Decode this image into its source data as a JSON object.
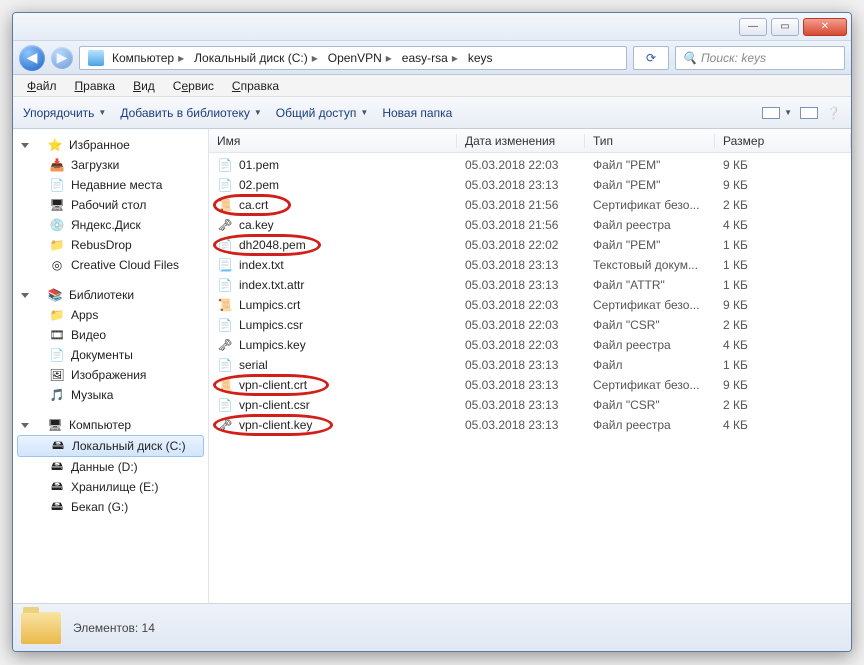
{
  "window": {
    "title": "keys"
  },
  "breadcrumb": [
    "Компьютер",
    "Локальный диск (C:)",
    "OpenVPN",
    "easy-rsa",
    "keys"
  ],
  "search": {
    "placeholder": "Поиск: keys"
  },
  "menubar": [
    "Файл",
    "Правка",
    "Вид",
    "Сервис",
    "Справка"
  ],
  "menubar_underline_index": [
    0,
    0,
    0,
    0,
    0
  ],
  "toolbar": {
    "organize": "Упорядочить",
    "addlib": "Добавить в библиотеку",
    "share": "Общий доступ",
    "newfolder": "Новая папка"
  },
  "columns": {
    "name": "Имя",
    "date": "Дата изменения",
    "type": "Тип",
    "size": "Размер"
  },
  "files": [
    {
      "name": "01.pem",
      "date": "05.03.2018 22:03",
      "type": "Файл \"PEM\"",
      "size": "9 КБ",
      "icon": "page",
      "highlight": false
    },
    {
      "name": "02.pem",
      "date": "05.03.2018 23:13",
      "type": "Файл \"PEM\"",
      "size": "9 КБ",
      "icon": "page",
      "highlight": false
    },
    {
      "name": "ca.crt",
      "date": "05.03.2018 21:56",
      "type": "Сертификат безо...",
      "size": "2 КБ",
      "icon": "cert",
      "highlight": true,
      "ringw": 78
    },
    {
      "name": "ca.key",
      "date": "05.03.2018 21:56",
      "type": "Файл реестра",
      "size": "4 КБ",
      "icon": "reg",
      "highlight": false
    },
    {
      "name": "dh2048.pem",
      "date": "05.03.2018 22:02",
      "type": "Файл \"PEM\"",
      "size": "1 КБ",
      "icon": "page",
      "highlight": true,
      "ringw": 108
    },
    {
      "name": "index.txt",
      "date": "05.03.2018 23:13",
      "type": "Текстовый докум...",
      "size": "1 КБ",
      "icon": "txt",
      "highlight": false
    },
    {
      "name": "index.txt.attr",
      "date": "05.03.2018 23:13",
      "type": "Файл \"ATTR\"",
      "size": "1 КБ",
      "icon": "page",
      "highlight": false
    },
    {
      "name": "Lumpics.crt",
      "date": "05.03.2018 22:03",
      "type": "Сертификат безо...",
      "size": "9 КБ",
      "icon": "cert",
      "highlight": false
    },
    {
      "name": "Lumpics.csr",
      "date": "05.03.2018 22:03",
      "type": "Файл \"CSR\"",
      "size": "2 КБ",
      "icon": "page",
      "highlight": false
    },
    {
      "name": "Lumpics.key",
      "date": "05.03.2018 22:03",
      "type": "Файл реестра",
      "size": "4 КБ",
      "icon": "reg",
      "highlight": false
    },
    {
      "name": "serial",
      "date": "05.03.2018 23:13",
      "type": "Файл",
      "size": "1 КБ",
      "icon": "page",
      "highlight": false
    },
    {
      "name": "vpn-client.crt",
      "date": "05.03.2018 23:13",
      "type": "Сертификат безо...",
      "size": "9 КБ",
      "icon": "cert",
      "highlight": true,
      "ringw": 116
    },
    {
      "name": "vpn-client.csr",
      "date": "05.03.2018 23:13",
      "type": "Файл \"CSR\"",
      "size": "2 КБ",
      "icon": "page",
      "highlight": false
    },
    {
      "name": "vpn-client.key",
      "date": "05.03.2018 23:13",
      "type": "Файл реестра",
      "size": "4 КБ",
      "icon": "reg",
      "highlight": true,
      "ringw": 120
    }
  ],
  "nav": {
    "favorites": {
      "header": "Избранное",
      "items": [
        {
          "label": "Загрузки",
          "icon": "📥"
        },
        {
          "label": "Недавние места",
          "icon": "📄"
        },
        {
          "label": "Рабочий стол",
          "icon": "🖥"
        },
        {
          "label": "Яндекс.Диск",
          "icon": "💿"
        },
        {
          "label": "RebusDrop",
          "icon": "📁"
        },
        {
          "label": "Creative Cloud Files",
          "icon": "◎"
        }
      ]
    },
    "libraries": {
      "header": "Библиотеки",
      "items": [
        {
          "label": "Apps",
          "icon": "📁"
        },
        {
          "label": "Видео",
          "icon": "🎞"
        },
        {
          "label": "Документы",
          "icon": "📄"
        },
        {
          "label": "Изображения",
          "icon": "🖼"
        },
        {
          "label": "Музыка",
          "icon": "🎵"
        }
      ]
    },
    "computer": {
      "header": "Компьютер",
      "items": [
        {
          "label": "Локальный диск (C:)",
          "icon": "🖴",
          "selected": true
        },
        {
          "label": "Данные (D:)",
          "icon": "🖴"
        },
        {
          "label": "Хранилище (E:)",
          "icon": "🖴"
        },
        {
          "label": "Бекап (G:)",
          "icon": "🖴"
        }
      ]
    }
  },
  "status": {
    "text": "Элементов: 14"
  }
}
